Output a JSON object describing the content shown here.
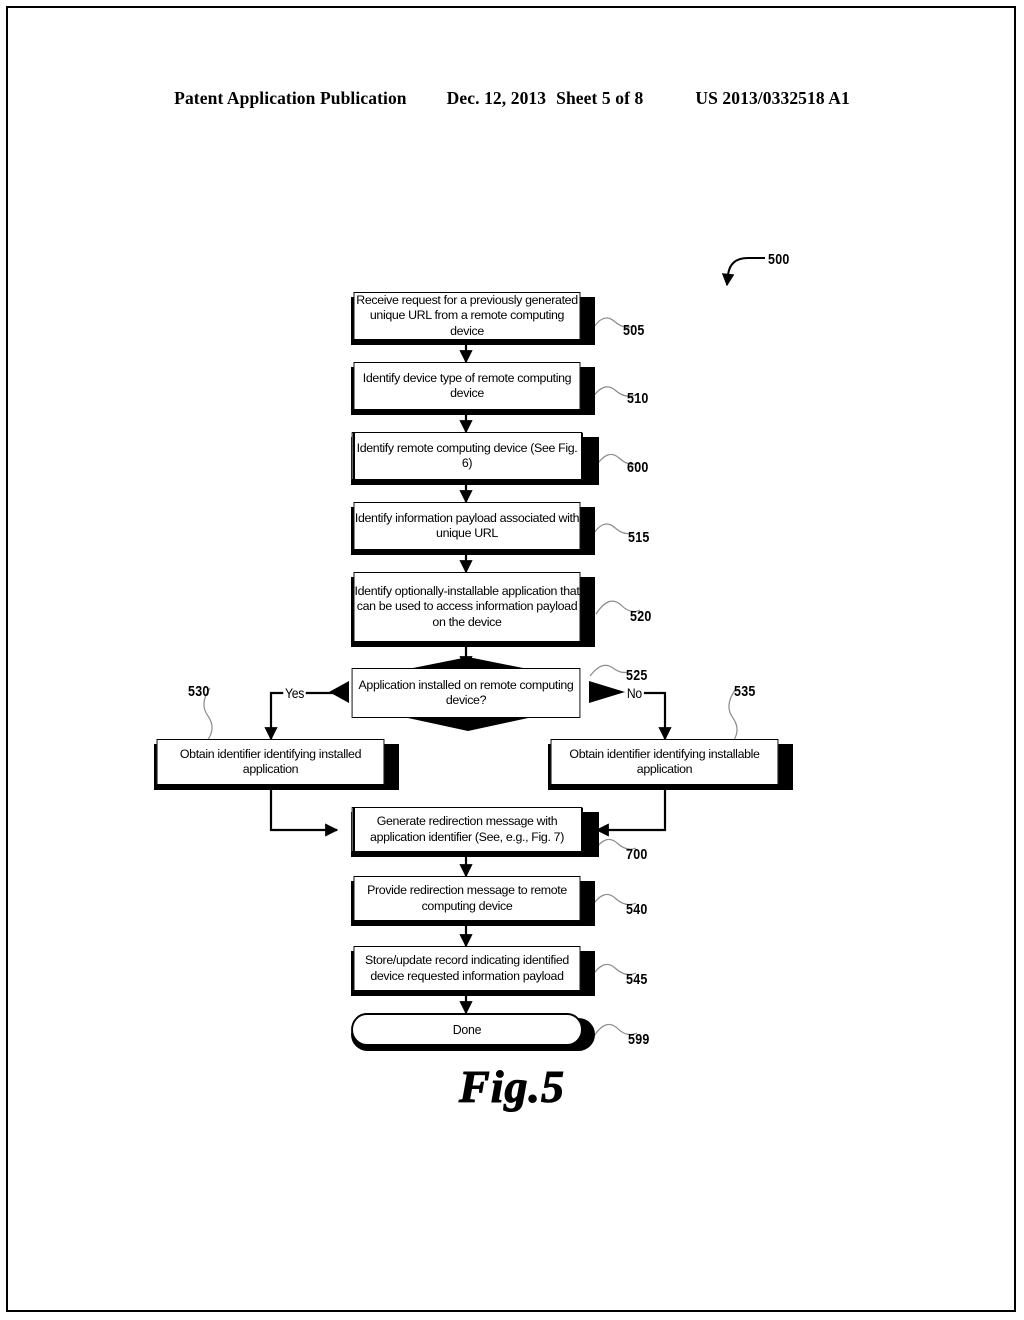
{
  "header": {
    "publication": "Patent Application Publication",
    "date": "Dec. 12, 2013",
    "sheet": "Sheet 5 of 8",
    "patent_number": "US 2013/0332518 A1"
  },
  "figure": {
    "caption": "Fig.5",
    "diagram_ref": "500"
  },
  "nodes": {
    "n505": {
      "text": "Receive request for a previously generated unique URL from a remote computing device",
      "ref": "505",
      "shape": "process"
    },
    "n510": {
      "text": "Identify device type of remote computing device",
      "ref": "510",
      "shape": "process"
    },
    "n600": {
      "text": "Identify remote computing device (See Fig. 6)",
      "ref": "600",
      "shape": "subroutine"
    },
    "n515": {
      "text": "Identify information payload associated with unique URL",
      "ref": "515",
      "shape": "process"
    },
    "n520": {
      "text": "Identify optionally-installable application that can be used to access information payload on the device",
      "ref": "520",
      "shape": "process"
    },
    "n525": {
      "text": "Application installed on remote computing device?",
      "ref": "525",
      "shape": "decision"
    },
    "n530": {
      "text": "Obtain identifier identifying installed application",
      "ref": "530",
      "shape": "process"
    },
    "n535": {
      "text": "Obtain identifier identifying installable application",
      "ref": "535",
      "shape": "process"
    },
    "n700": {
      "text": "Generate redirection message with application identifier (See, e.g., Fig. 7)",
      "ref": "700",
      "shape": "subroutine"
    },
    "n540": {
      "text": "Provide redirection message to remote computing device",
      "ref": "540",
      "shape": "process"
    },
    "n545": {
      "text": "Store/update record indicating identified device requested information payload",
      "ref": "545",
      "shape": "process"
    },
    "n599": {
      "text": "Done",
      "ref": "599",
      "shape": "terminator"
    }
  },
  "branches": {
    "yes": "Yes",
    "no": "No"
  },
  "colors": {
    "ink": "#000000",
    "paper": "#ffffff",
    "leader": "#8c8c8c"
  }
}
